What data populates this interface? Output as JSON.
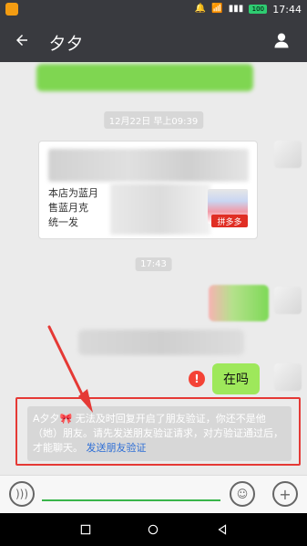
{
  "status_bar": {
    "battery": "100",
    "time": "17:44"
  },
  "header": {
    "title": "夕夕",
    "back_icon": "back-arrow-icon",
    "profile_icon": "profile-icon"
  },
  "chat": {
    "timestamp1": "12月22日 早上09:39",
    "card": {
      "line1": "本店为蓝月",
      "line2": "售蓝月克",
      "line3": "统一发",
      "badge": "拼多多"
    },
    "timestamp2": "17:43",
    "sent_message": "在吗",
    "system_message": {
      "text": "A夕夕🎀 无法及时回复开启了朋友验证，你还不是他（她）朋友。请先发送朋友验证请求，对方验证通过后，才能聊天。",
      "link": "发送朋友验证"
    }
  },
  "input_bar": {
    "voice_icon": "voice-icon",
    "emoji_icon": "emoji-icon",
    "plus_icon": "plus-icon"
  },
  "navbar": {
    "back_icon": "nav-back-icon",
    "home_icon": "nav-home-icon",
    "recent_icon": "nav-recent-icon"
  }
}
